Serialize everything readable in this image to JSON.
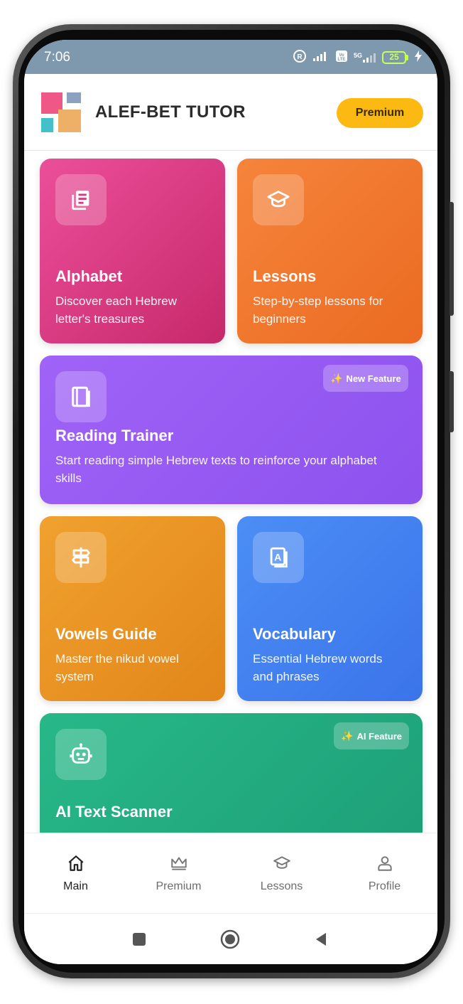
{
  "status_bar": {
    "time": "7:06",
    "battery": "25",
    "network": "5G",
    "background_color": "#7e98ad"
  },
  "header": {
    "app_title": "ALEF-BET TUTOR",
    "premium_button": "Premium",
    "premium_color": "#fbb911"
  },
  "cards": [
    {
      "id": "alphabet",
      "title": "Alphabet",
      "description": "Discover each Hebrew letter's treasures",
      "icon": "book-list-icon",
      "colors": [
        "#ec4f9a",
        "#c6296a"
      ]
    },
    {
      "id": "lessons",
      "title": "Lessons",
      "description": "Step-by-step lessons for beginners",
      "icon": "graduation-cap-icon",
      "colors": [
        "#f6843b",
        "#eb6b22"
      ]
    },
    {
      "id": "reading-trainer",
      "title": "Reading Trainer",
      "description": "Start reading simple Hebrew texts to reinforce your alphabet skills",
      "icon": "open-book-icon",
      "badge": "New Feature",
      "badge_icon": "sparkle-icon",
      "colors": [
        "#a063f7",
        "#8d52ee"
      ]
    },
    {
      "id": "vowels-guide",
      "title": "Vowels Guide",
      "description": "Master the nikud vowel system",
      "icon": "signpost-icon",
      "colors": [
        "#f0a12e",
        "#e2861a"
      ]
    },
    {
      "id": "vocabulary",
      "title": "Vocabulary",
      "description": "Essential Hebrew words and phrases",
      "icon": "dictionary-icon",
      "colors": [
        "#4b8ef5",
        "#3b74ea"
      ]
    },
    {
      "id": "ai-text-scanner",
      "title": "AI Text Scanner",
      "description": "",
      "icon": "robot-icon",
      "badge": "AI Feature",
      "badge_icon": "sparkle-icon",
      "colors": [
        "#27b888",
        "#1e9f77"
      ]
    }
  ],
  "bottom_nav": {
    "items": [
      {
        "label": "Main",
        "icon": "home-icon",
        "active": true
      },
      {
        "label": "Premium",
        "icon": "crown-icon",
        "active": false
      },
      {
        "label": "Lessons",
        "icon": "graduation-cap-icon",
        "active": false
      },
      {
        "label": "Profile",
        "icon": "person-icon",
        "active": false
      }
    ]
  },
  "system_nav": {
    "buttons": [
      "recents-icon",
      "home-circle-icon",
      "back-triangle-icon"
    ]
  }
}
